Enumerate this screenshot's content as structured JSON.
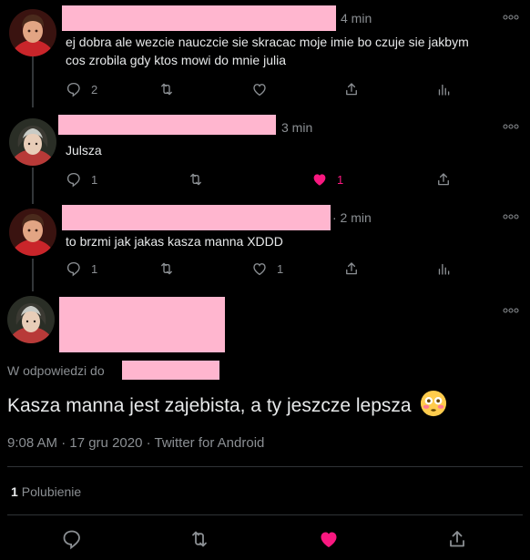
{
  "tweets": [
    {
      "time": "4 min",
      "text_line1": "ej dobra ale wezcie nauczcie sie skracac moje imie bo czuje sie jakbym",
      "text_line2": "cos zrobila gdy ktos mowi do mnie julia",
      "replies": "2",
      "retweets": "",
      "likes": "",
      "liked": false
    },
    {
      "time": "3 min",
      "text_line1": "Julsza",
      "replies": "1",
      "retweets": "",
      "likes": "1",
      "liked": true
    },
    {
      "time": "· 2 min",
      "text_line1": "to brzmi jak jakas kasza manna XDDD",
      "replies": "1",
      "retweets": "",
      "likes": "1",
      "liked": false
    }
  ],
  "main_tweet": {
    "replying_label": "W odpowiedzi do",
    "text": "Kasza manna jest zajebista, a ty jeszcze lepsza",
    "emoji": "flushed-face-emoji",
    "meta": "9:08 AM · 17 gru 2020 · Twitter for Android",
    "like_count": "1",
    "like_label": "Polubienie"
  },
  "colors": {
    "background": "#000000",
    "redaction": "#ffb6cf",
    "like": "#f91880",
    "muted": "#8b8f93",
    "text": "#e7e9ea"
  }
}
